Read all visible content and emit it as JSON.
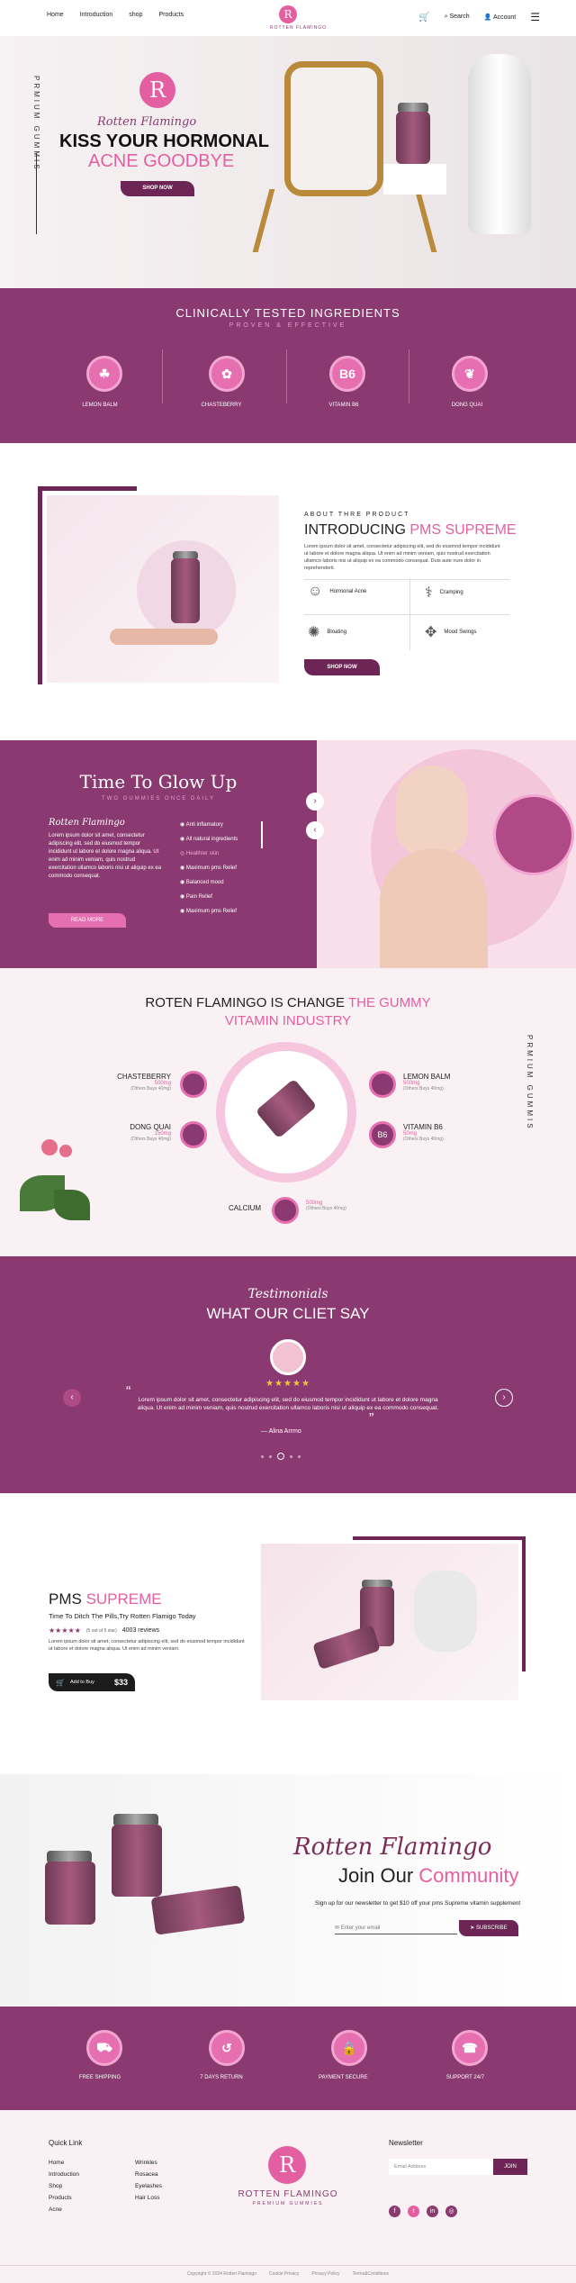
{
  "header": {
    "nav": [
      "Home",
      "Introduction",
      "shop",
      "Products"
    ],
    "logo_name": "ROTTEN FLAMINGO",
    "logo_sub": "PREMIUM GUMMIES",
    "search": "Search",
    "account": "Account",
    "cart_count": "0"
  },
  "hero": {
    "vertical": "PRMIUM GUMMIS",
    "script": "Rotten Flamingo",
    "line1": "KISS YOUR HORMONAL",
    "line2": "ACNE GOODBYE",
    "button": "SHOP NOW"
  },
  "ingredients": {
    "title": "CLINICALLY TESTED INGREDIENTS",
    "subtitle": "PROVEN & EFFECTIVE",
    "items": [
      {
        "label": "LEMON BALM",
        "icon": "lemon-icon"
      },
      {
        "label": "CHASTEBERRY",
        "icon": "berry-icon"
      },
      {
        "label": "VITAMIN B6",
        "icon": "b6-icon",
        "text": "B6"
      },
      {
        "label": "DONG QUAI",
        "icon": "leaf-icon"
      }
    ]
  },
  "about": {
    "eyebrow": "ABOUT THRE PRODUCT",
    "title1": "INTRODUCING ",
    "title2": "PMS SUPREME",
    "body": "Lorem ipsum dolor sit amet, consectetur adipiscing elit, sed do eiusmod tempor incididunt ut labore et dolore magna aliqua. Ut enim ad minim veniam, quis nostrud exercitation ullamco laboris nisi ut aliquip ex ea commodo consequat. Duis aute irure dolor in reprehenderit.",
    "features": [
      "Hormonal Acne",
      "Cramping",
      "Bloating",
      "Mood Swings"
    ],
    "button": "SHOP NOW"
  },
  "glow": {
    "title": "Time To Glow Up",
    "subtitle": "TWO GUMMIES ONCE DAILY",
    "script": "Rotten Flamingo",
    "body": "Lorem ipsum dolor sit amet, consectetur adipiscing elit, sed do eiusmod tempor incididunt ut labore et dolore magna aliqua. Ut enim ad minim veniam, quis nostrud exercitation ullamco laboris nisi ut aliquip ex ea commodo consequat.",
    "button": "READ MORE",
    "list": [
      "Anti inflamatory",
      "All natural ingredients",
      "Healthier skin",
      "Maximum pms Relief",
      "Balanced mood",
      "Pain Relief",
      "Maximum pms Relief"
    ]
  },
  "change": {
    "title1": "ROTEN FLAMINGO IS CHANGE ",
    "title2": "THE GUMMY",
    "title3": "VITAMIN INDUSTRY",
    "vertical": "PRMIUM GUMMIS",
    "items": [
      {
        "name": "CHASTEBERRY",
        "mg": "500mg",
        "sub": "(Others Buys 40mg)"
      },
      {
        "name": "LEMON BALM",
        "mg": "500mg",
        "sub": "(Others Buys 40mg)"
      },
      {
        "name": "DONG QUAI",
        "mg": "150mg",
        "sub": "(Others Buys 40mg)"
      },
      {
        "name": "VITAMIN B6",
        "mg": "50mg",
        "sub": "(Others Buys 40mg)"
      },
      {
        "name": "CALCIUM",
        "mg": "500mg",
        "sub": "(Others Buys 40mg)"
      }
    ]
  },
  "testimonials": {
    "script": "Testimonials",
    "title": "WHAT OUR CLIET SAY",
    "stars": "★★★★★",
    "quote": "Lorem ipsum dolor sit amet, consectetur adipiscing elit, sed do eiusmod tempor incididunt ut labore et dolore magna aliqua. Ut enim ad minim veniam, quis nostrud exercitation ullamco laboris nisi ut aliquip ex ea commodo consequat.",
    "author": "Alina Arrmo"
  },
  "product": {
    "title1": "PMS ",
    "title2": "SUPREME",
    "tagline": "Time To Ditch The Pills,Try Rotten  Flamigo Today",
    "stars": "★★★★★",
    "rating": "(5 out of 5 star)",
    "reviews": "4003 reviews",
    "body": "Lorem ipsum dolor sit amet, consectetur adipiscing elit, sed do eiusmod tempor incididunt ut labore et dolore magna aliqua. Ut enim ad minim veniam.",
    "cart_label": "Add to Buy",
    "price": "$33"
  },
  "community": {
    "script": "Rotten Flamingo",
    "title1": "Join Our ",
    "title2": "Community",
    "sub": "Sign up for our newsletter to get $10 off your pms Supreme vitamin supplement",
    "placeholder": "Enter your email",
    "button": "SUBSCRIBE"
  },
  "benefits": [
    {
      "label": "FREE SHIPPING",
      "icon": "truck-icon"
    },
    {
      "label": "7 DAYS RETURN",
      "icon": "return-icon"
    },
    {
      "label": "PAYMENT SECURE",
      "icon": "secure-icon"
    },
    {
      "label": "SUPPORT 24/7",
      "icon": "support-icon"
    }
  ],
  "footer": {
    "quick_title": "Quick Link",
    "col1": [
      "Home",
      "Introduction",
      "Shop",
      "Products",
      "Acne"
    ],
    "col2": [
      "Wrinkles",
      "Rosacea",
      "Eyelashes",
      "Hair Loss"
    ],
    "logo_name": "ROTTEN FLAMINGO",
    "logo_sub": "PREMIUM GUMMIES",
    "news_title": "Newsletter",
    "news_placeholder": "Email Address",
    "news_button": "JOIN",
    "copyright": "Copyright © 2024 Rotten Flamingo",
    "links": [
      "Cookie Privacy",
      "Privacy Policy",
      "Terms&Conditions"
    ]
  },
  "colors": {
    "plum": "#8a3a70",
    "pink": "#e45fa2",
    "dark": "#6d2556"
  }
}
